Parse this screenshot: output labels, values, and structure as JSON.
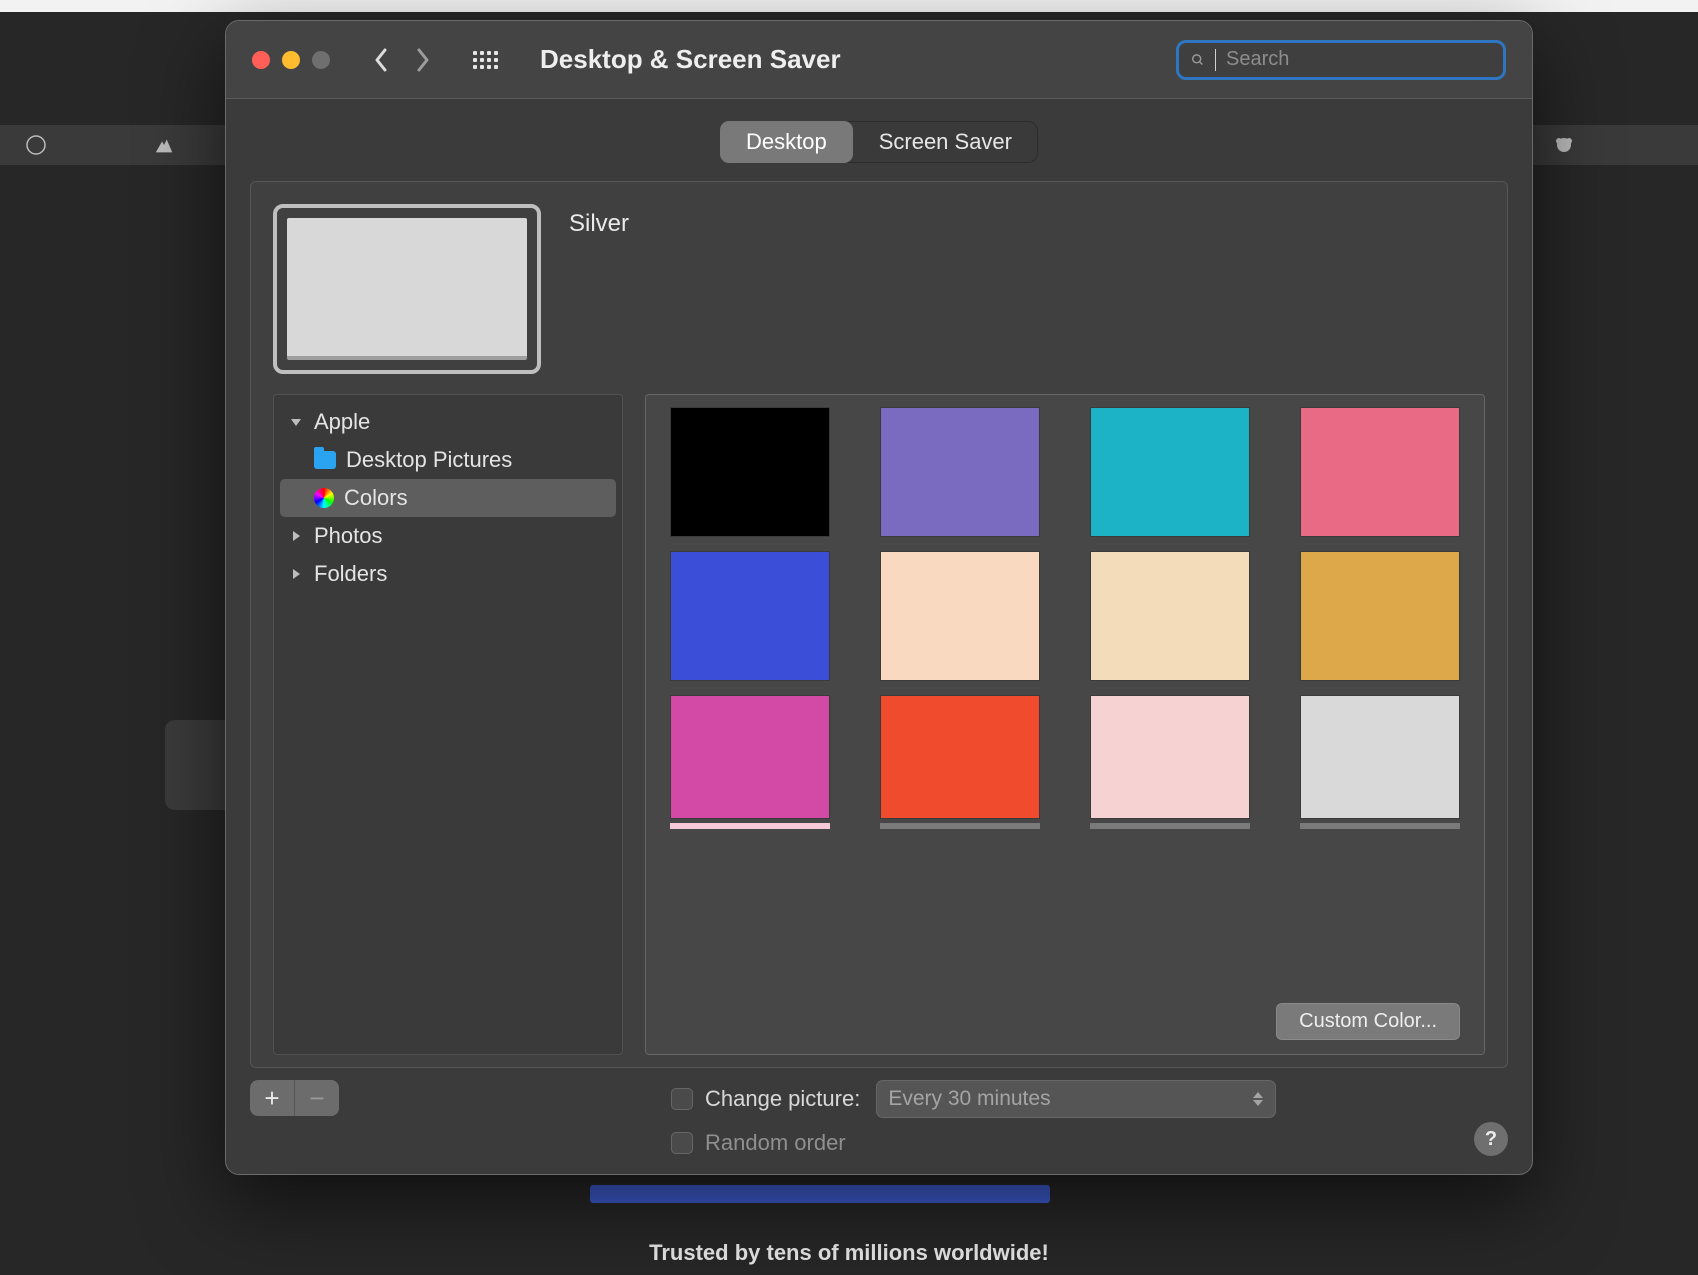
{
  "window": {
    "title": "Desktop & Screen Saver",
    "search_placeholder": "Search"
  },
  "tabs": {
    "desktop": "Desktop",
    "screen_saver": "Screen Saver"
  },
  "preview": {
    "current_name": "Silver"
  },
  "sidebar": {
    "apple": "Apple",
    "desktop_pictures": "Desktop Pictures",
    "colors": "Colors",
    "photos": "Photos",
    "folders": "Folders"
  },
  "swatches": {
    "colors": [
      "#000000",
      "#7a6bc0",
      "#1cb3c6",
      "#e86a84",
      "#3a4ed8",
      "#f9d9c0",
      "#f3dcba",
      "#dca84a",
      "#d24aa5",
      "#f04b2c",
      "#f6d2d2",
      "#d9d9d9"
    ],
    "strip_colors": [
      "#f6c9d8",
      "#7a7a7a",
      "#7a7a7a",
      "#7a7a7a"
    ],
    "custom_color_label": "Custom Color..."
  },
  "controls": {
    "change_picture_label": "Change picture:",
    "change_picture_value": "Every 30 minutes",
    "random_order_label": "Random order",
    "help_label": "?"
  },
  "backdrop": {
    "trusted": "Trusted by tens of millions worldwide!"
  }
}
